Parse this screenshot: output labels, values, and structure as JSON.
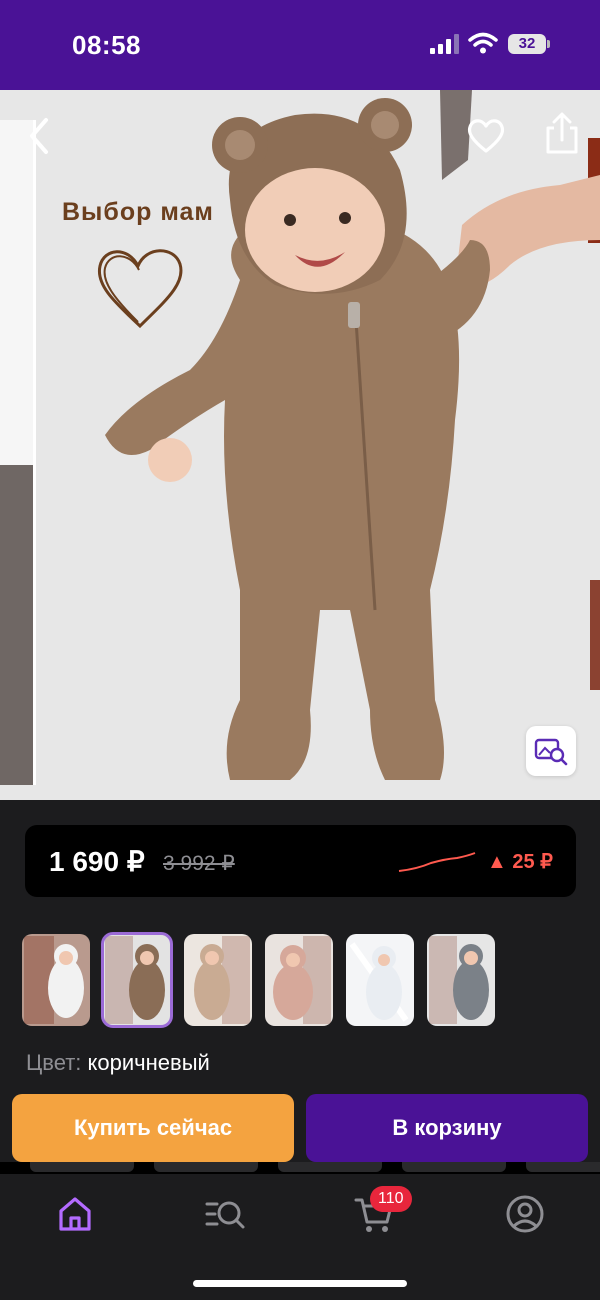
{
  "status_bar": {
    "time": "08:58",
    "battery": "32",
    "icons": [
      "signal-icon",
      "wifi-icon",
      "battery-icon"
    ]
  },
  "product_image": {
    "tagline": "Выбор мам",
    "icons": [
      "back-arrow-icon",
      "heart-outline-icon",
      "share-icon",
      "image-search-icon",
      "heart-doodle-icon"
    ]
  },
  "price": {
    "current": "1 690 ₽",
    "old": "3 992 ₽",
    "change": "▲ 25 ₽",
    "trend_color": "#ff5a4f"
  },
  "thumbnails": [
    {
      "name": "white-bear-suit",
      "color": "#f2f2f2",
      "selected": false
    },
    {
      "name": "brown-bear-suit",
      "color": "#8a6d56",
      "selected": true
    },
    {
      "name": "beige-bear-suit",
      "color": "#c9ab93",
      "selected": false
    },
    {
      "name": "pink-bear-suit",
      "color": "#d6a89a",
      "selected": false
    },
    {
      "name": "light-grey-suit",
      "color": "#e9edf2",
      "selected": false
    },
    {
      "name": "grey-bear-suit",
      "color": "#7b8188",
      "selected": false
    }
  ],
  "color_selection": {
    "label": "Цвет:",
    "value": "коричневый"
  },
  "actions": {
    "buy_now": "Купить сейчас",
    "add_to_cart": "В корзину"
  },
  "tab_bar": {
    "items": [
      "home-icon",
      "catalog-search-icon",
      "cart-icon",
      "profile-icon"
    ],
    "cart_badge": "110",
    "active_color": "#b36bff",
    "inactive_color": "#8e8e93"
  },
  "colors": {
    "brand_purple": "#4a1296",
    "buy_orange": "#f4a340"
  }
}
